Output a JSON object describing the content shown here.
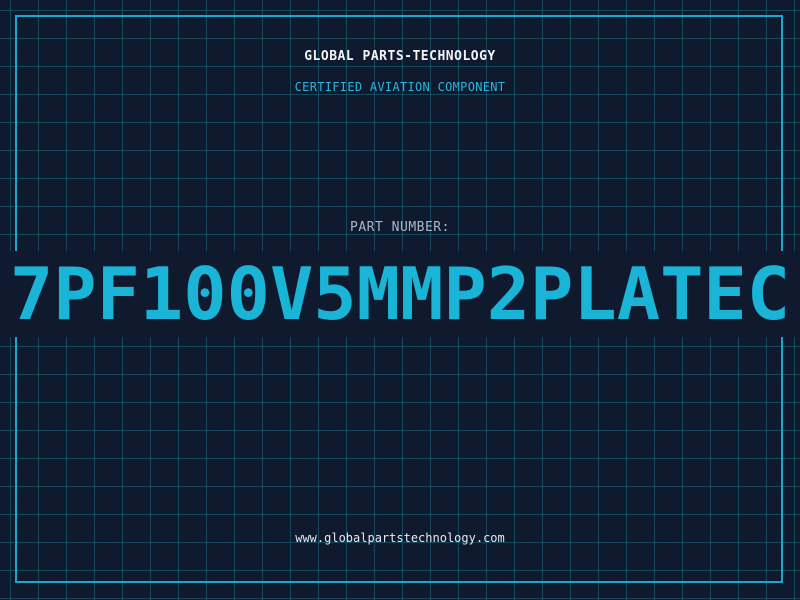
{
  "header": {
    "brand": "GLOBAL PARTS-TECHNOLOGY",
    "subtitle": "CERTIFIED AVIATION COMPONENT"
  },
  "part": {
    "label": "PART NUMBER:",
    "number": "7PF100V5MMP2PLATEC"
  },
  "footer": {
    "url": "www.globalpartstechnology.com"
  },
  "colors": {
    "background": "#101a2e",
    "grid": "#1c6e84",
    "frame": "#1ea6c8",
    "accent": "#19b4d6",
    "brand_text": "#f2f4f7",
    "label_text": "#a8b6c8"
  }
}
